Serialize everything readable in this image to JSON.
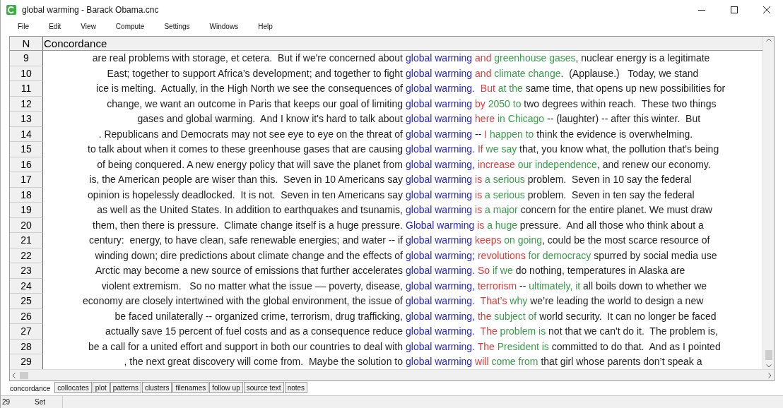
{
  "window": {
    "title": "global warming - Barack Obama.cnc"
  },
  "menu": [
    "File",
    "Edit",
    "View",
    "Compute",
    "Settings",
    "Windows",
    "Help"
  ],
  "table": {
    "columns": [
      "N",
      "Concordance"
    ],
    "rows": [
      {
        "n": "9",
        "left": "are real problems with storage, et cetera.  But if we're concerned about",
        "segments": [
          {
            "text": "global warming",
            "kind": "node"
          },
          {
            "text": " and",
            "kind": "first"
          },
          {
            "text": " greenhouse gases",
            "kind": "second"
          },
          {
            "text": ", nuclear energy is a legitimate",
            "kind": "plain"
          }
        ]
      },
      {
        "n": "10",
        "left": "East; together to support Africa’s development; and together to fight",
        "segments": [
          {
            "text": "global warming",
            "kind": "node"
          },
          {
            "text": " and",
            "kind": "first"
          },
          {
            "text": " climate change",
            "kind": "second"
          },
          {
            "text": ".  (Applause.)   Today, we stand",
            "kind": "plain"
          }
        ]
      },
      {
        "n": "11",
        "left": "ice is melting.  Actually, in the High North we see the consequences of",
        "segments": [
          {
            "text": "global warming.",
            "kind": "node"
          },
          {
            "text": "  But",
            "kind": "first"
          },
          {
            "text": " at the",
            "kind": "second"
          },
          {
            "text": " same time, that opens up new possibilities for",
            "kind": "plain"
          }
        ]
      },
      {
        "n": "12",
        "left": "change, we want an outcome in Paris that keeps our goal of limiting",
        "segments": [
          {
            "text": "global warming",
            "kind": "node"
          },
          {
            "text": " by",
            "kind": "first"
          },
          {
            "text": " 2050 to",
            "kind": "second"
          },
          {
            "text": " two degrees within reach.  These two things",
            "kind": "plain"
          }
        ]
      },
      {
        "n": "13",
        "left": "gases and global warming.  And I know it's hard to talk about",
        "segments": [
          {
            "text": "global warming",
            "kind": "node"
          },
          {
            "text": " here",
            "kind": "first"
          },
          {
            "text": " in Chicago",
            "kind": "second"
          },
          {
            "text": " -- (laughter) -- after this winter.  But",
            "kind": "plain"
          }
        ]
      },
      {
        "n": "14",
        "left": ". Republicans and Democrats may not see eye to eye on the threat of",
        "segments": [
          {
            "text": "global warming",
            "kind": "node"
          },
          {
            "text": " --",
            "kind": "plain"
          },
          {
            "text": " I",
            "kind": "first"
          },
          {
            "text": " happen to",
            "kind": "second"
          },
          {
            "text": " think the evidence is overwhelming.",
            "kind": "plain"
          }
        ]
      },
      {
        "n": "15",
        "left": "to talk about when it comes to these greenhouse gases that are causing",
        "segments": [
          {
            "text": "global warming.",
            "kind": "node"
          },
          {
            "text": " If",
            "kind": "first"
          },
          {
            "text": " we say",
            "kind": "second"
          },
          {
            "text": " that, you know what, the pollution that's being",
            "kind": "plain"
          }
        ]
      },
      {
        "n": "16",
        "left": "of being conquered. A new energy policy that will save the planet from",
        "segments": [
          {
            "text": "global warming,",
            "kind": "node"
          },
          {
            "text": " increase",
            "kind": "first"
          },
          {
            "text": " our independence",
            "kind": "second"
          },
          {
            "text": ", and renew our economy.",
            "kind": "plain"
          }
        ]
      },
      {
        "n": "17",
        "left": "is, the American people are wiser than this.  Seven in 10 Americans say",
        "segments": [
          {
            "text": "global warming",
            "kind": "node"
          },
          {
            "text": " is",
            "kind": "first"
          },
          {
            "text": " a serious",
            "kind": "second"
          },
          {
            "text": " problem.  Seven in 10 say the federal",
            "kind": "plain"
          }
        ]
      },
      {
        "n": "18",
        "left": "opinion is hopelessly deadlocked.  It is not.  Seven in ten Americans say",
        "segments": [
          {
            "text": "global warming",
            "kind": "node"
          },
          {
            "text": " is",
            "kind": "first"
          },
          {
            "text": " a serious",
            "kind": "second"
          },
          {
            "text": " problem.  Seven in ten say the federal",
            "kind": "plain"
          }
        ]
      },
      {
        "n": "19",
        "left": "as well as the United States. In addition to earthquakes and tsunamis,",
        "segments": [
          {
            "text": "global warming",
            "kind": "node"
          },
          {
            "text": " is",
            "kind": "first"
          },
          {
            "text": " a major",
            "kind": "second"
          },
          {
            "text": " concern for the entire planet. We must draw",
            "kind": "plain"
          }
        ]
      },
      {
        "n": "20",
        "left": "them, then there is pressure.  Climate change itself is a huge pressure.",
        "segments": [
          {
            "text": "Global warming",
            "kind": "node"
          },
          {
            "text": " is",
            "kind": "first"
          },
          {
            "text": " a huge",
            "kind": "second"
          },
          {
            "text": " pressure.  And all those who think about a",
            "kind": "plain"
          }
        ]
      },
      {
        "n": "21",
        "left": "century:  energy, to have clean, safe renewable energies; and water -- if",
        "segments": [
          {
            "text": "global warming",
            "kind": "node"
          },
          {
            "text": " keeps",
            "kind": "first"
          },
          {
            "text": " on going",
            "kind": "second"
          },
          {
            "text": ", could be the most scarce resource of",
            "kind": "plain"
          }
        ]
      },
      {
        "n": "22",
        "left": "winding down; dire predictions about climate change and the effects of",
        "segments": [
          {
            "text": "global warming;",
            "kind": "node"
          },
          {
            "text": " revolutions",
            "kind": "first"
          },
          {
            "text": " for democracy",
            "kind": "second"
          },
          {
            "text": " spurred by social media use",
            "kind": "plain"
          }
        ]
      },
      {
        "n": "23",
        "left": "Arctic may become a new source of emissions that further accelerates",
        "segments": [
          {
            "text": "global warming.",
            "kind": "node"
          },
          {
            "text": " So",
            "kind": "first"
          },
          {
            "text": " if we",
            "kind": "second"
          },
          {
            "text": " do nothing, temperatures in Alaska are",
            "kind": "plain"
          }
        ]
      },
      {
        "n": "24",
        "left": "violent extremism.   So no matter what the issue –– poverty, disease,",
        "segments": [
          {
            "text": "global warming,",
            "kind": "node"
          },
          {
            "text": " terrorism",
            "kind": "first"
          },
          {
            "text": " --",
            "kind": "plain"
          },
          {
            "text": " ultimately, it",
            "kind": "second"
          },
          {
            "text": " all boils down to whether we",
            "kind": "plain"
          }
        ]
      },
      {
        "n": "25",
        "left": "economy are closely intertwined with the global environment, the issue of",
        "segments": [
          {
            "text": "global warming.",
            "kind": "node"
          },
          {
            "text": "  That’s",
            "kind": "first"
          },
          {
            "text": " why",
            "kind": "second"
          },
          {
            "text": " we’re leading the world to design a new",
            "kind": "plain"
          }
        ]
      },
      {
        "n": "26",
        "left": "be faced unilaterally -- organized crime, terrorism, drug trafficking,",
        "segments": [
          {
            "text": "global warming,",
            "kind": "node"
          },
          {
            "text": " the",
            "kind": "first"
          },
          {
            "text": " subject of",
            "kind": "second"
          },
          {
            "text": " world security.  It can no longer be faced",
            "kind": "plain"
          }
        ]
      },
      {
        "n": "27",
        "left": "actually save 15 percent of fuel costs and as a consequence reduce",
        "segments": [
          {
            "text": "global warming.",
            "kind": "node"
          },
          {
            "text": "  The",
            "kind": "first"
          },
          {
            "text": " problem is",
            "kind": "second"
          },
          {
            "text": " not that we can't do it.  The problem is,",
            "kind": "plain"
          }
        ]
      },
      {
        "n": "28",
        "left": "be a call for a united effort and support in both our countries to deal with",
        "segments": [
          {
            "text": "global warming.",
            "kind": "node"
          },
          {
            "text": " The",
            "kind": "first"
          },
          {
            "text": " President is",
            "kind": "second"
          },
          {
            "text": " committed to do that.  And as I pointed",
            "kind": "plain"
          }
        ]
      },
      {
        "n": "29",
        "left": ", the next great discovery will come from.  Maybe the solution to",
        "segments": [
          {
            "text": "global warming",
            "kind": "node"
          },
          {
            "text": " will",
            "kind": "first"
          },
          {
            "text": " come from",
            "kind": "second"
          },
          {
            "text": " that girl whose parents don’t speak a",
            "kind": "plain"
          }
        ]
      }
    ]
  },
  "tabs": [
    {
      "label": "concordance",
      "selected": true
    },
    {
      "label": "collocates",
      "selected": false
    },
    {
      "label": "plot",
      "selected": false
    },
    {
      "label": "patterns",
      "selected": false
    },
    {
      "label": "clusters",
      "selected": false
    },
    {
      "label": "filenames",
      "selected": false
    },
    {
      "label": "follow up",
      "selected": false
    },
    {
      "label": "source text",
      "selected": false
    },
    {
      "label": "notes",
      "selected": false
    }
  ],
  "status_bar": [
    "29",
    "Set"
  ]
}
